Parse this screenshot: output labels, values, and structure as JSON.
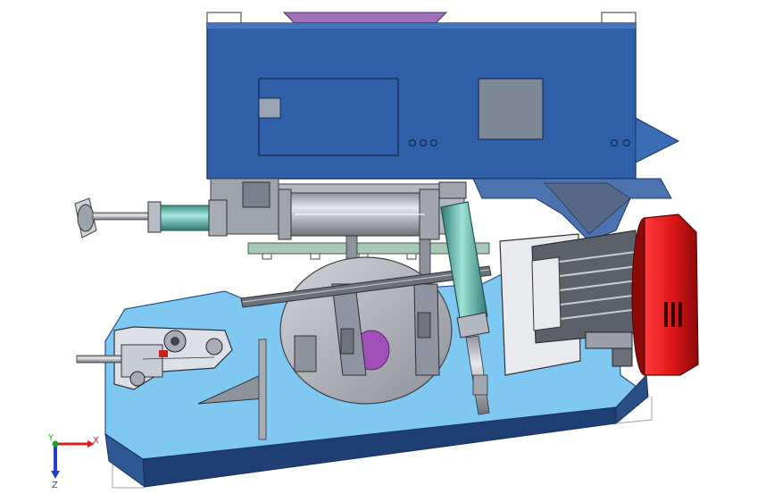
{
  "triad": {
    "x_label": "X",
    "y_label": "Y",
    "z_label": "Z",
    "x_color": "#d81e1e",
    "y_color": "#1fa31f",
    "z_color": "#2440c8"
  },
  "colors": {
    "housing_blue": "#3060a8",
    "base_light_blue": "#7ec8f2",
    "base_dark_blue": "#1f3f74",
    "pulley_red": "#e01818",
    "cylinder_teal": "#5aa8a0",
    "steel_grey": "#b7b9c0",
    "purple_accent": "#8a4aa8"
  },
  "components": [
    "housing",
    "base-plate",
    "motor",
    "red-pulley",
    "cylinder",
    "linear-actuator",
    "saw-blade-disc",
    "fixture"
  ]
}
